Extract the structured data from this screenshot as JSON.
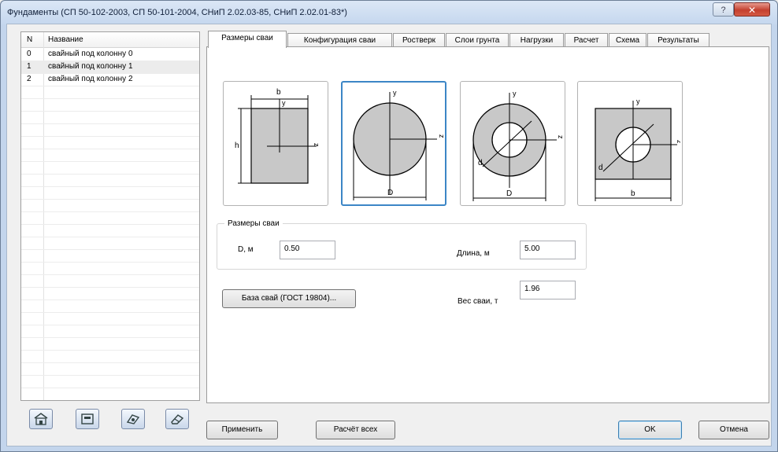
{
  "window": {
    "title": "Фундаменты (СП 50-102-2003, СП 50-101-2004, СНиП 2.02.03-85, СНиП 2.02.01-83*)",
    "help_glyph": "?",
    "close_glyph": "✕"
  },
  "list": {
    "headers": {
      "n": "N",
      "name": "Название"
    },
    "rows": [
      {
        "n": "0",
        "name": "свайный под колонну 0"
      },
      {
        "n": "1",
        "name": "свайный под колонну 1"
      },
      {
        "n": "2",
        "name": "свайный под колонну 2"
      }
    ],
    "selected_index": 1
  },
  "tabs": [
    {
      "label": "Размеры сваи"
    },
    {
      "label": "Конфигурация сваи"
    },
    {
      "label": "Ростверк"
    },
    {
      "label": "Слои грунта"
    },
    {
      "label": "Нагрузки"
    },
    {
      "label": "Расчет"
    },
    {
      "label": "Схема"
    },
    {
      "label": "Результаты"
    }
  ],
  "active_tab": 0,
  "piles": {
    "rect": {
      "b": "b",
      "h": "h",
      "y": "y",
      "z": "z"
    },
    "circle": {
      "D": "D",
      "y": "y",
      "z": "z"
    },
    "ring": {
      "D": "D",
      "d": "d",
      "y": "y",
      "z": "z"
    },
    "square_hole": {
      "b": "b",
      "d": "d",
      "y": "y",
      "z": "z"
    },
    "selected": "circle"
  },
  "sizes": {
    "group_label": "Размеры сваи",
    "d_label": "D, м",
    "d_value": "0.50",
    "length_label": "Длина, м",
    "length_value": "5.00",
    "weight_label": "Вес сваи, т",
    "weight_value": "1.96",
    "db_button": "База свай (ГОСТ 19804)..."
  },
  "footer": {
    "apply": "Применить",
    "calc_all": "Расчёт всех",
    "ok": "OK",
    "cancel": "Отмена"
  },
  "colors": {
    "accent_border": "#3c86c6",
    "pile_fill": "#c8c8c8",
    "close_button": "#c4402f"
  }
}
